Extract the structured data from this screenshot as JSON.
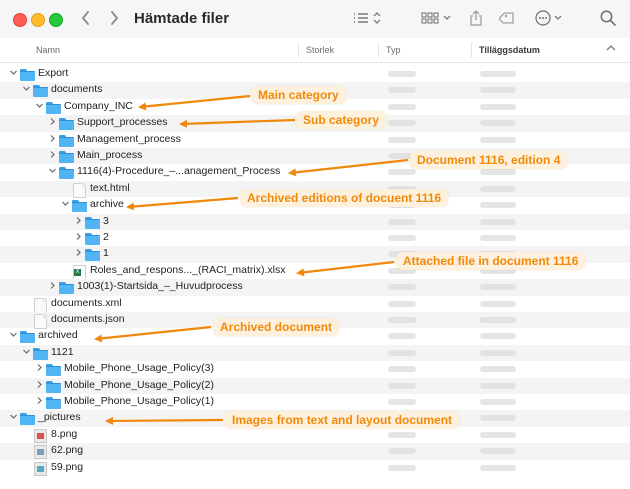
{
  "window": {
    "title": "Hämtade filer"
  },
  "toolbar": {
    "back_icon": "chevron-left-icon",
    "forward_icon": "chevron-right-icon",
    "view_icon": "list-view-icon",
    "group_icon": "grid-group-icon",
    "share_icon": "share-icon",
    "tag_icon": "tag-icon",
    "more_icon": "ellipsis-circle-icon",
    "search_icon": "search-icon"
  },
  "columns": {
    "name": "Namn",
    "size": "Storlek",
    "kind": "Typ",
    "date_added": "Tilläggsdatum"
  },
  "rows": [
    {
      "label": "Export",
      "type": "folder",
      "depth": 0,
      "expanded": true
    },
    {
      "label": "documents",
      "type": "folder",
      "depth": 1,
      "expanded": true
    },
    {
      "label": "Company_INC",
      "type": "folder",
      "depth": 2,
      "expanded": true
    },
    {
      "label": "Support_processes",
      "type": "folder",
      "depth": 3,
      "expanded": false
    },
    {
      "label": "Management_process",
      "type": "folder",
      "depth": 3,
      "expanded": false
    },
    {
      "label": "Main_process",
      "type": "folder",
      "depth": 3,
      "expanded": false
    },
    {
      "label": "1116(4)-Procedure_–...anagement_Process",
      "type": "folder",
      "depth": 3,
      "expanded": true
    },
    {
      "label": "text.html",
      "type": "file",
      "depth": 4
    },
    {
      "label": "archive",
      "type": "folder",
      "depth": 4,
      "expanded": true
    },
    {
      "label": "3",
      "type": "folder",
      "depth": 5,
      "expanded": false
    },
    {
      "label": "2",
      "type": "folder",
      "depth": 5,
      "expanded": false
    },
    {
      "label": "1",
      "type": "folder",
      "depth": 5,
      "expanded": false
    },
    {
      "label": "Roles_and_respons..._(RACI_matrix).xlsx",
      "type": "xlsx",
      "depth": 4
    },
    {
      "label": "1003(1)-Startsida_–_Huvudprocess",
      "type": "folder",
      "depth": 3,
      "expanded": false
    },
    {
      "label": "documents.xml",
      "type": "file",
      "depth": 1
    },
    {
      "label": "documents.json",
      "type": "file",
      "depth": 1
    },
    {
      "label": "archived",
      "type": "folder",
      "depth": 0,
      "expanded": true
    },
    {
      "label": "1121",
      "type": "folder",
      "depth": 1,
      "expanded": true
    },
    {
      "label": "Mobile_Phone_Usage_Policy(3)",
      "type": "folder",
      "depth": 2,
      "expanded": false
    },
    {
      "label": "Mobile_Phone_Usage_Policy(2)",
      "type": "folder",
      "depth": 2,
      "expanded": false
    },
    {
      "label": "Mobile_Phone_Usage_Policy(1)",
      "type": "folder",
      "depth": 2,
      "expanded": false
    },
    {
      "label": "_pictures",
      "type": "folder",
      "depth": 0,
      "expanded": true
    },
    {
      "label": "8.png",
      "type": "img8",
      "depth": 1
    },
    {
      "label": "62.png",
      "type": "img62",
      "depth": 1
    },
    {
      "label": "59.png",
      "type": "img59",
      "depth": 1
    }
  ],
  "annotations": [
    {
      "text": "Main category",
      "target_row": 2
    },
    {
      "text": "Sub category",
      "target_row": 3
    },
    {
      "text": "Document 1116, edition 4",
      "target_row": 6
    },
    {
      "text": "Archived editions of docuent 1116",
      "target_row": 8
    },
    {
      "text": "Attached file in document 1116",
      "target_row": 12
    },
    {
      "text": "Archived document",
      "target_row": 16
    },
    {
      "text": "Images from text and layout document",
      "target_row": 21
    }
  ],
  "colors": {
    "annotation_text": "#f08a0c",
    "annotation_bg": "#fdf0dc",
    "arrow": "#f0890a",
    "folder": "#51b4f5"
  }
}
